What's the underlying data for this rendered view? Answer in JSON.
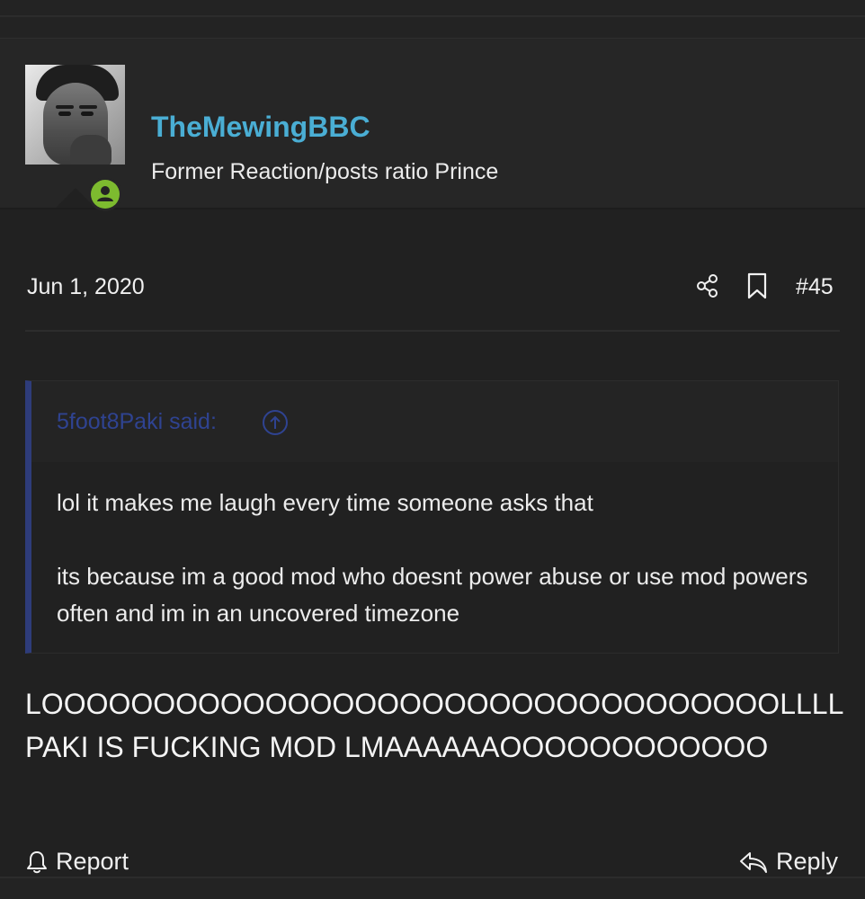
{
  "post": {
    "username": "TheMewingBBC",
    "user_title": "Former Reaction/posts ratio Prince",
    "date": "Jun 1, 2020",
    "post_number": "#45",
    "quote": {
      "author": "5foot8Paki said:",
      "paragraphs": [
        "lol it makes me laugh every time someone asks that",
        "its because im a good mod who doesnt power abuse or use mod powers often and im in an uncovered timezone"
      ]
    },
    "body": "LOOOOOOOOOOOOOOOOOOOOOOOOOOOOOOOOOLLLL PAKI IS FUCKING MOD LMAAAAAAOOOOOOOOOOOO",
    "actions": {
      "report": "Report",
      "reply": "Reply"
    }
  },
  "icons": {
    "online_status": "user-online-icon",
    "share": "share-icon",
    "bookmark": "bookmark-icon",
    "quote_jump": "arrow-up-circle-icon",
    "report": "bell-icon",
    "reply": "reply-arrow-icon"
  },
  "colors": {
    "background": "#212121",
    "header_background": "#262626",
    "username": "#4aaed4",
    "quote_bar": "#2e3c7a",
    "quote_author": "#2f4391",
    "online_badge": "#7dbb2f"
  }
}
